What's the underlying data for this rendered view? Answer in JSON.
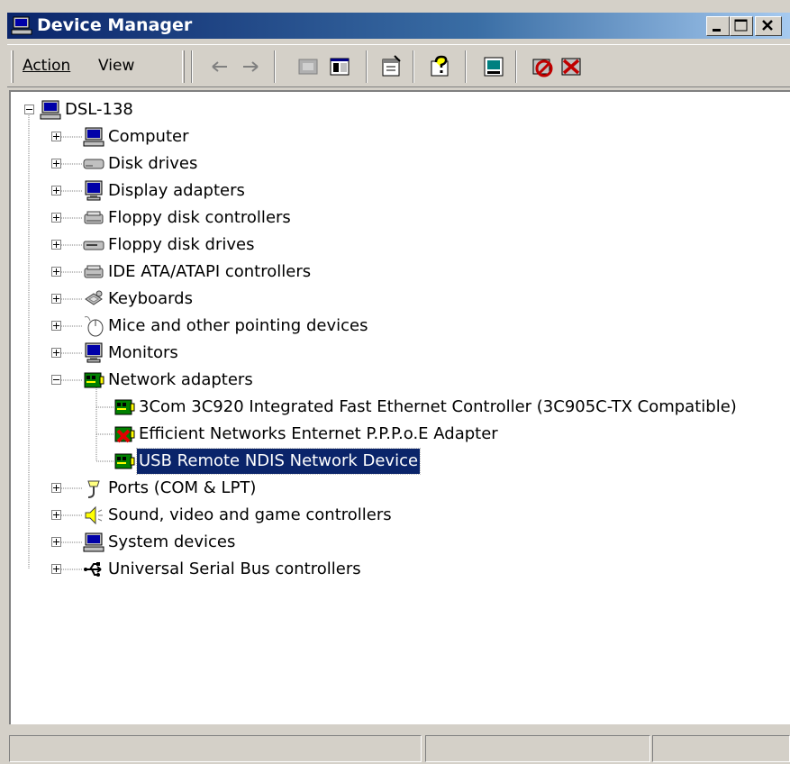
{
  "window": {
    "title": "Device Manager"
  },
  "menu": {
    "action": "Action",
    "view": "View"
  },
  "toolbar": {
    "buttons": [
      "back-icon",
      "forward-icon",
      "up-folder-icon",
      "show-hide-tree-icon",
      "properties-icon",
      "help-icon",
      "scan-hardware-icon",
      "disable-device-icon",
      "uninstall-device-icon"
    ]
  },
  "tree": {
    "root": "DSL-138",
    "categories": [
      {
        "label": "Computer",
        "icon": "computer-icon"
      },
      {
        "label": "Disk drives",
        "icon": "disk-drive-icon"
      },
      {
        "label": "Display adapters",
        "icon": "monitor-icon"
      },
      {
        "label": "Floppy disk controllers",
        "icon": "controller-icon"
      },
      {
        "label": "Floppy disk drives",
        "icon": "floppy-drive-icon"
      },
      {
        "label": "IDE ATA/ATAPI controllers",
        "icon": "controller-icon"
      },
      {
        "label": "Keyboards",
        "icon": "keyboard-icon"
      },
      {
        "label": "Mice and other pointing devices",
        "icon": "mouse-icon"
      },
      {
        "label": "Monitors",
        "icon": "monitor-icon"
      },
      {
        "label": "Network adapters",
        "icon": "network-card-icon"
      },
      {
        "label": "Ports (COM & LPT)",
        "icon": "port-icon"
      },
      {
        "label": "Sound, video and game controllers",
        "icon": "speaker-icon"
      },
      {
        "label": "System devices",
        "icon": "computer-icon"
      },
      {
        "label": "Universal Serial Bus controllers",
        "icon": "usb-icon"
      }
    ],
    "network_children": [
      {
        "label": "3Com 3C920 Integrated Fast Ethernet Controller (3C905C-TX Compatible)",
        "icon": "network-card-icon"
      },
      {
        "label": "Efficient Networks Enternet P.P.P.o.E Adapter",
        "icon": "network-card-disabled-icon"
      },
      {
        "label": "USB Remote NDIS Network Device",
        "icon": "network-card-icon",
        "selected": true
      }
    ]
  },
  "colors": {
    "title_start": "#0a246a",
    "title_end": "#a6caf0",
    "selection": "#0a246a",
    "chrome": "#d4d0c8"
  }
}
